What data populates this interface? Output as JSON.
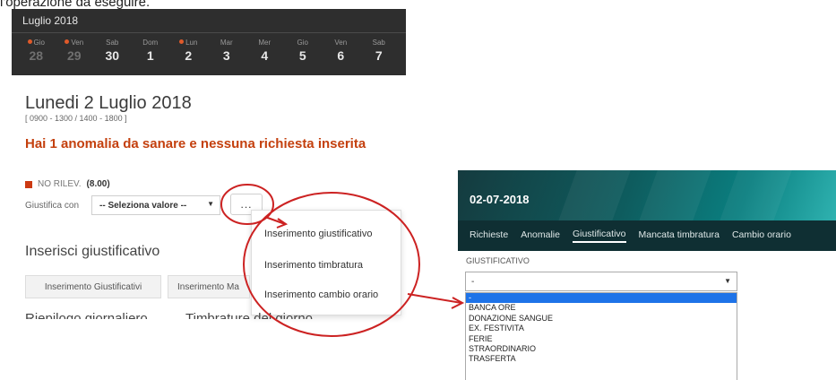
{
  "caption": "l'operazione da eseguire.",
  "calendar": {
    "month": "Luglio 2018",
    "days": [
      {
        "dow": "Gio",
        "num": "28",
        "past": true,
        "dot": true
      },
      {
        "dow": "Ven",
        "num": "29",
        "past": true,
        "dot": true
      },
      {
        "dow": "Sab",
        "num": "30",
        "past": false,
        "dot": false
      },
      {
        "dow": "Dom",
        "num": "1",
        "past": false,
        "dot": false
      },
      {
        "dow": "Lun",
        "num": "2",
        "past": false,
        "dot": true
      },
      {
        "dow": "Mar",
        "num": "3",
        "past": false,
        "dot": false
      },
      {
        "dow": "Mer",
        "num": "4",
        "past": false,
        "dot": false
      },
      {
        "dow": "Gio",
        "num": "5",
        "past": false,
        "dot": false
      },
      {
        "dow": "Ven",
        "num": "6",
        "past": false,
        "dot": false
      },
      {
        "dow": "Sab",
        "num": "7",
        "past": false,
        "dot": false
      }
    ]
  },
  "detail": {
    "title": "Lunedi 2 Luglio 2018",
    "hours": "[ 0900 - 1300 / 1400 - 1800 ]",
    "anomaly_message": "Hai 1 anomalia da sanare e nessuna richiesta inserita",
    "norilev_label": "NO RILEV.",
    "norilev_value": "(8.00)",
    "giustifica_label": "Giustifica con",
    "select_value": "-- Seleziona valore --",
    "dots_label": "...",
    "menu": [
      "Inserimento giustificativo",
      "Inserimento timbratura",
      "Inserimento cambio orario"
    ],
    "section_title": "Inserisci giustificativo",
    "btn_giustificativi": "Inserimento Giustificativi",
    "btn_ma": "Inserimento Ma",
    "cut_left": "Riepilogo giornaliero",
    "cut_right": "Timbrature del giorno"
  },
  "right": {
    "date": "02-07-2018",
    "tabs": [
      "Richieste",
      "Anomalie",
      "Giustificativo",
      "Mancata timbratura",
      "Cambio orario"
    ],
    "field_label": "GIUSTIFICATIVO",
    "selected": "-",
    "options": [
      "-",
      "BANCA ORE",
      "DONAZIONE SANGUE",
      "EX. FESTIVITA",
      "FERIE",
      "STRAORDINARIO",
      "TRASFERTA"
    ]
  },
  "colors": {
    "accent_red": "#c4400e",
    "annotation_red": "#cc2222",
    "calendar_bg": "#2e2e2e",
    "header_teal": "#0a7f80",
    "selected_blue": "#1e73e8"
  }
}
